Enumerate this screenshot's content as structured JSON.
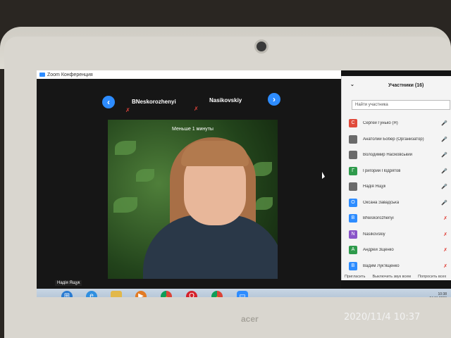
{
  "window": {
    "title": "Zoom Конференция"
  },
  "gallery": {
    "prev_icon": "‹",
    "next_icon": "›",
    "speakers": [
      "BNeskorozhenyi",
      "Nasikovskiy"
    ],
    "timer_label": "Меньше 1 минуты",
    "self_label": "Надія Ящук"
  },
  "panel": {
    "title": "Участники (16)",
    "search_placeholder": "Найти участника",
    "participants": [
      {
        "initial": "С",
        "name": "Сергей Гунько (Я)",
        "color": "#e04a3a"
      },
      {
        "initial": "",
        "name": "Анатолий Бобер (Организатор)",
        "color": "#6a6a6a"
      },
      {
        "initial": "",
        "name": "Володимир Насіковський",
        "color": "#6a6a6a"
      },
      {
        "initial": "Г",
        "name": "Григорий Подрятов",
        "color": "#2e9a4b"
      },
      {
        "initial": "",
        "name": "Надія Ящук",
        "color": "#6a6a6a"
      },
      {
        "initial": "О",
        "name": "Оксана Завадська",
        "color": "#2d8cff"
      },
      {
        "initial": "B",
        "name": "BNeskorozhenyi",
        "color": "#2d8cff"
      },
      {
        "initial": "N",
        "name": "Nasikovskiy",
        "color": "#8a55c9"
      },
      {
        "initial": "А",
        "name": "Андрей Зщенко",
        "color": "#2e9a4b"
      },
      {
        "initial": "В",
        "name": "Вадим Лук'ященко",
        "color": "#2d8cff"
      }
    ],
    "footer": [
      "Пригласить",
      "Выключить звук всем",
      "Попросить всех"
    ]
  },
  "taskbar": {
    "icons": [
      "windows-start",
      "ie",
      "explorer",
      "media",
      "chrome",
      "opera",
      "chrome-2",
      "zoom"
    ]
  },
  "photo_timestamp": "2020/11/4  10:37",
  "hardware": {
    "brand": "acer"
  }
}
